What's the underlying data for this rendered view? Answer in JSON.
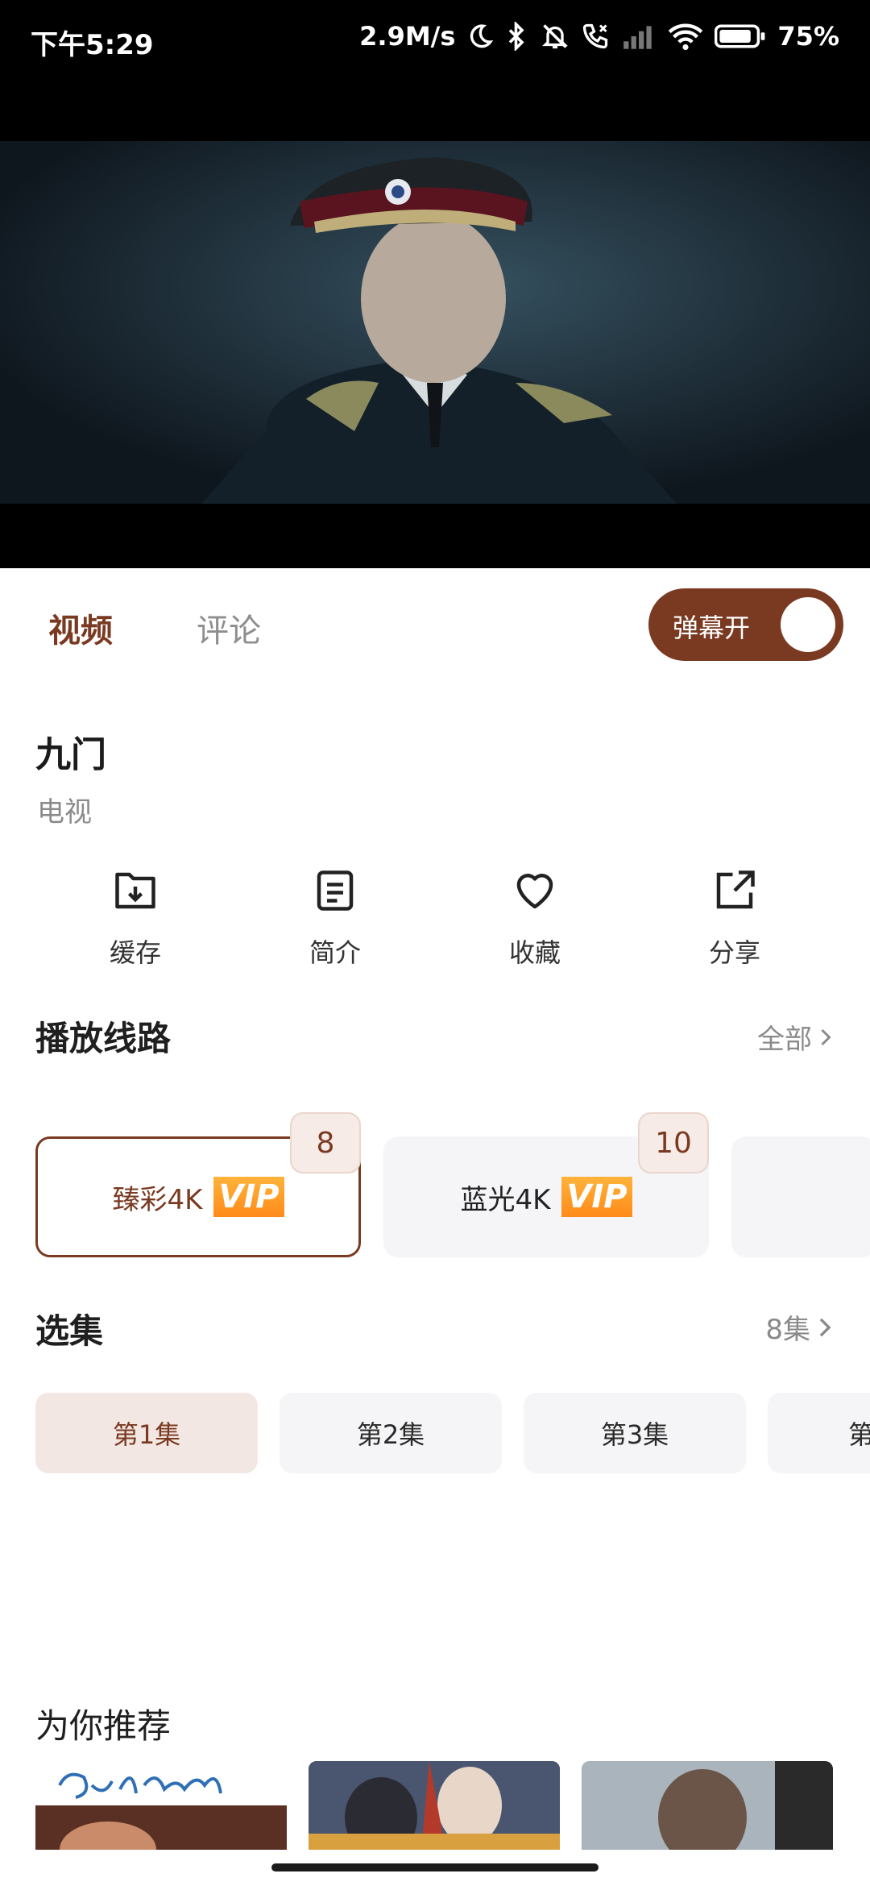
{
  "status_bar": {
    "time": "下午5:29",
    "speed": "2.9M/s",
    "battery": "75%"
  },
  "tabs": {
    "video": "视频",
    "comments": "评论",
    "danmaku": "弹幕开"
  },
  "show": {
    "title": "九门",
    "category": "电视"
  },
  "actions": [
    {
      "label": "缓存",
      "icon": "download-folder-icon"
    },
    {
      "label": "简介",
      "icon": "document-icon"
    },
    {
      "label": "收藏",
      "icon": "heart-icon"
    },
    {
      "label": "分享",
      "icon": "share-icon"
    }
  ],
  "routes_section": {
    "title": "播放线路",
    "more": "全部"
  },
  "routes": [
    {
      "name": "臻彩4K",
      "tag": "VIP",
      "count": "8"
    },
    {
      "name": "蓝光4K",
      "tag": "VIP",
      "count": "10"
    }
  ],
  "episodes_section": {
    "title": "选集",
    "more": "8集"
  },
  "episodes": [
    "第1集",
    "第2集",
    "第3集",
    "第"
  ],
  "recommend": {
    "title": "为你推荐"
  },
  "colors": {
    "accent": "#7a3a22",
    "chip_bg": "#f5f5f7",
    "selected_bg": "#f3e7e3",
    "vip_orange": "#ff9a24"
  }
}
